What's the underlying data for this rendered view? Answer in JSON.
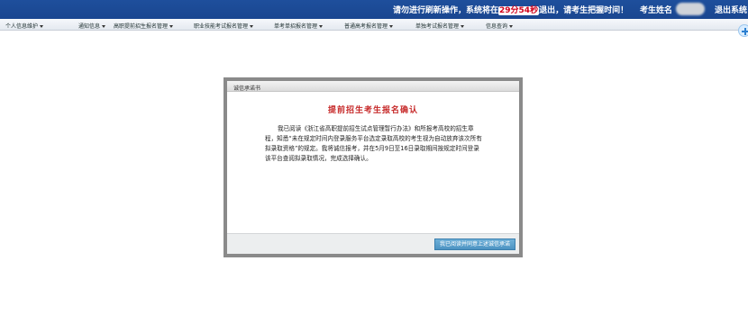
{
  "topbar": {
    "notice_prefix": "请勿进行刷新操作，系统将在",
    "timer": "29分54秒",
    "notice_suffix": "退出，请考生把握时间！",
    "student_label": "考生姓名",
    "logout_label": "退出系统"
  },
  "nav": {
    "items": [
      {
        "label": "个人信息维护"
      },
      {
        "label": "通知信息"
      },
      {
        "label": "高职提前招生报名管理"
      },
      {
        "label": "职业技能考试报名管理"
      },
      {
        "label": "单考单招报名管理"
      },
      {
        "label": "普通高考报名管理"
      },
      {
        "label": "单独考试报名管理"
      },
      {
        "label": "信息查询"
      }
    ]
  },
  "dialog": {
    "title": "诚信承诺书",
    "heading": "提前招生考生报名确认",
    "body": "我已阅读《浙江省高职提前招生试点管理暂行办法》和所报考高校的招生章程，知悉“未在规定时间内登录服务平台选定录取高校的考生视为自动放弃该次所有拟录取资格”的规定。我将诚信报考，并在5月9日至16日录取期间按规定时间登录该平台查阅拟录取情况，完成选择确认。",
    "confirm_label": "我已阅读并同意上述诚信承诺"
  }
}
